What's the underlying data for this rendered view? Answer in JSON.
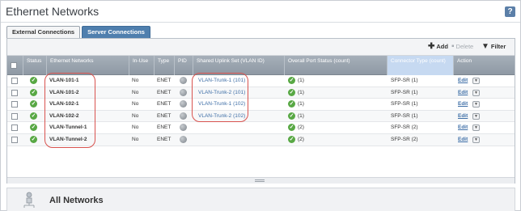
{
  "header": {
    "title": "Ethernet Networks",
    "help": "?"
  },
  "tabs": [
    {
      "label": "External Connections",
      "active": true
    },
    {
      "label": "Server Connections",
      "active": false
    }
  ],
  "toolbar": {
    "add": "Add",
    "delete": "Delete",
    "filter": "Filter"
  },
  "table": {
    "columns": [
      "Status",
      "Ethernet Networks",
      "In-Use",
      "Type",
      "PID",
      "Shared Uplink Set (VLAN ID)",
      "Overall Port Status (count)",
      "Connector Type (count)",
      "Action"
    ],
    "rows": [
      {
        "name": "VLAN-101-1",
        "in_use": "No",
        "type": "ENET",
        "uplink": "VLAN-Trunk-1 (101)",
        "port_status": "(1)",
        "connector": "SFP-SR (1)",
        "edit": "Edit"
      },
      {
        "name": "VLAN-101-2",
        "in_use": "No",
        "type": "ENET",
        "uplink": "VLAN-Trunk-2 (101)",
        "port_status": "(1)",
        "connector": "SFP-SR (1)",
        "edit": "Edit"
      },
      {
        "name": "VLAN-102-1",
        "in_use": "No",
        "type": "ENET",
        "uplink": "VLAN-Trunk-1 (102)",
        "port_status": "(1)",
        "connector": "SFP-SR (1)",
        "edit": "Edit"
      },
      {
        "name": "VLAN-102-2",
        "in_use": "No",
        "type": "ENET",
        "uplink": "VLAN-Trunk-2 (102)",
        "port_status": "(1)",
        "connector": "SFP-SR (1)",
        "edit": "Edit"
      },
      {
        "name": "VLAN-Tunnel-1",
        "in_use": "No",
        "type": "ENET",
        "uplink": "",
        "port_status": "(2)",
        "connector": "SFP-SR (2)",
        "edit": "Edit"
      },
      {
        "name": "VLAN-Tunnel-2",
        "in_use": "No",
        "type": "ENET",
        "uplink": "",
        "port_status": "(2)",
        "connector": "SFP-SR (2)",
        "edit": "Edit"
      }
    ]
  },
  "bottom": {
    "title": "All Networks"
  },
  "colors": {
    "annotation": "#d9534f",
    "link": "#3f6fa7",
    "status_ok": "#58a844",
    "header_bg": "#8f99a4",
    "tab_inactive": "#4f7fae"
  }
}
